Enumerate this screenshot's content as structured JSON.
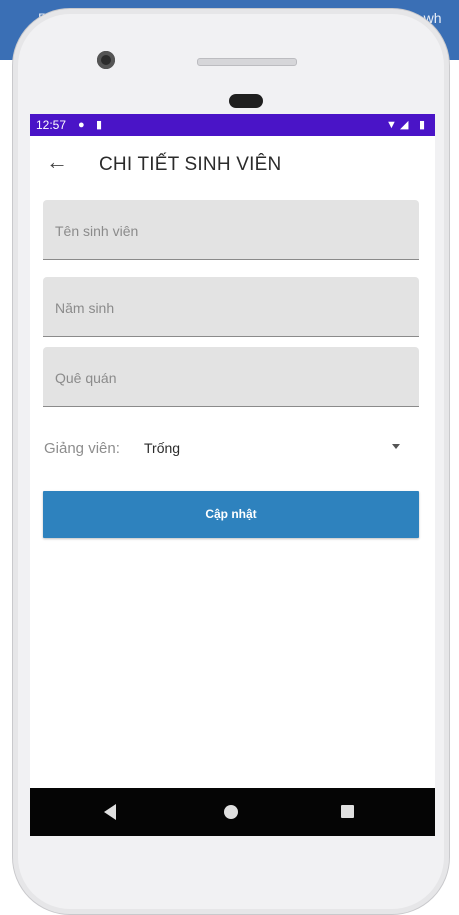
{
  "background": {
    "left_text": "P",
    "right_text": "e wh",
    "color": "#3a6fb5"
  },
  "statusbar": {
    "time": "12:57",
    "icons": [
      "p-icon",
      "sd-card-icon",
      "wifi-icon",
      "signal-icon",
      "battery-icon"
    ],
    "color": "#4a14c7"
  },
  "toolbar": {
    "back_icon": "arrow-left-icon",
    "title": "CHI TIẾT SINH VIÊN"
  },
  "form": {
    "student_name_placeholder": "Tên sinh viên",
    "birth_year_placeholder": "Năm sinh",
    "hometown_placeholder": "Quê quán",
    "lecturer_label": "Giảng viên:",
    "lecturer_selected": "Trống",
    "update_button": "Cập nhật",
    "button_color": "#2e82be"
  },
  "navbar": {
    "icons": [
      "back-triangle-icon",
      "home-circle-icon",
      "recents-square-icon"
    ]
  }
}
